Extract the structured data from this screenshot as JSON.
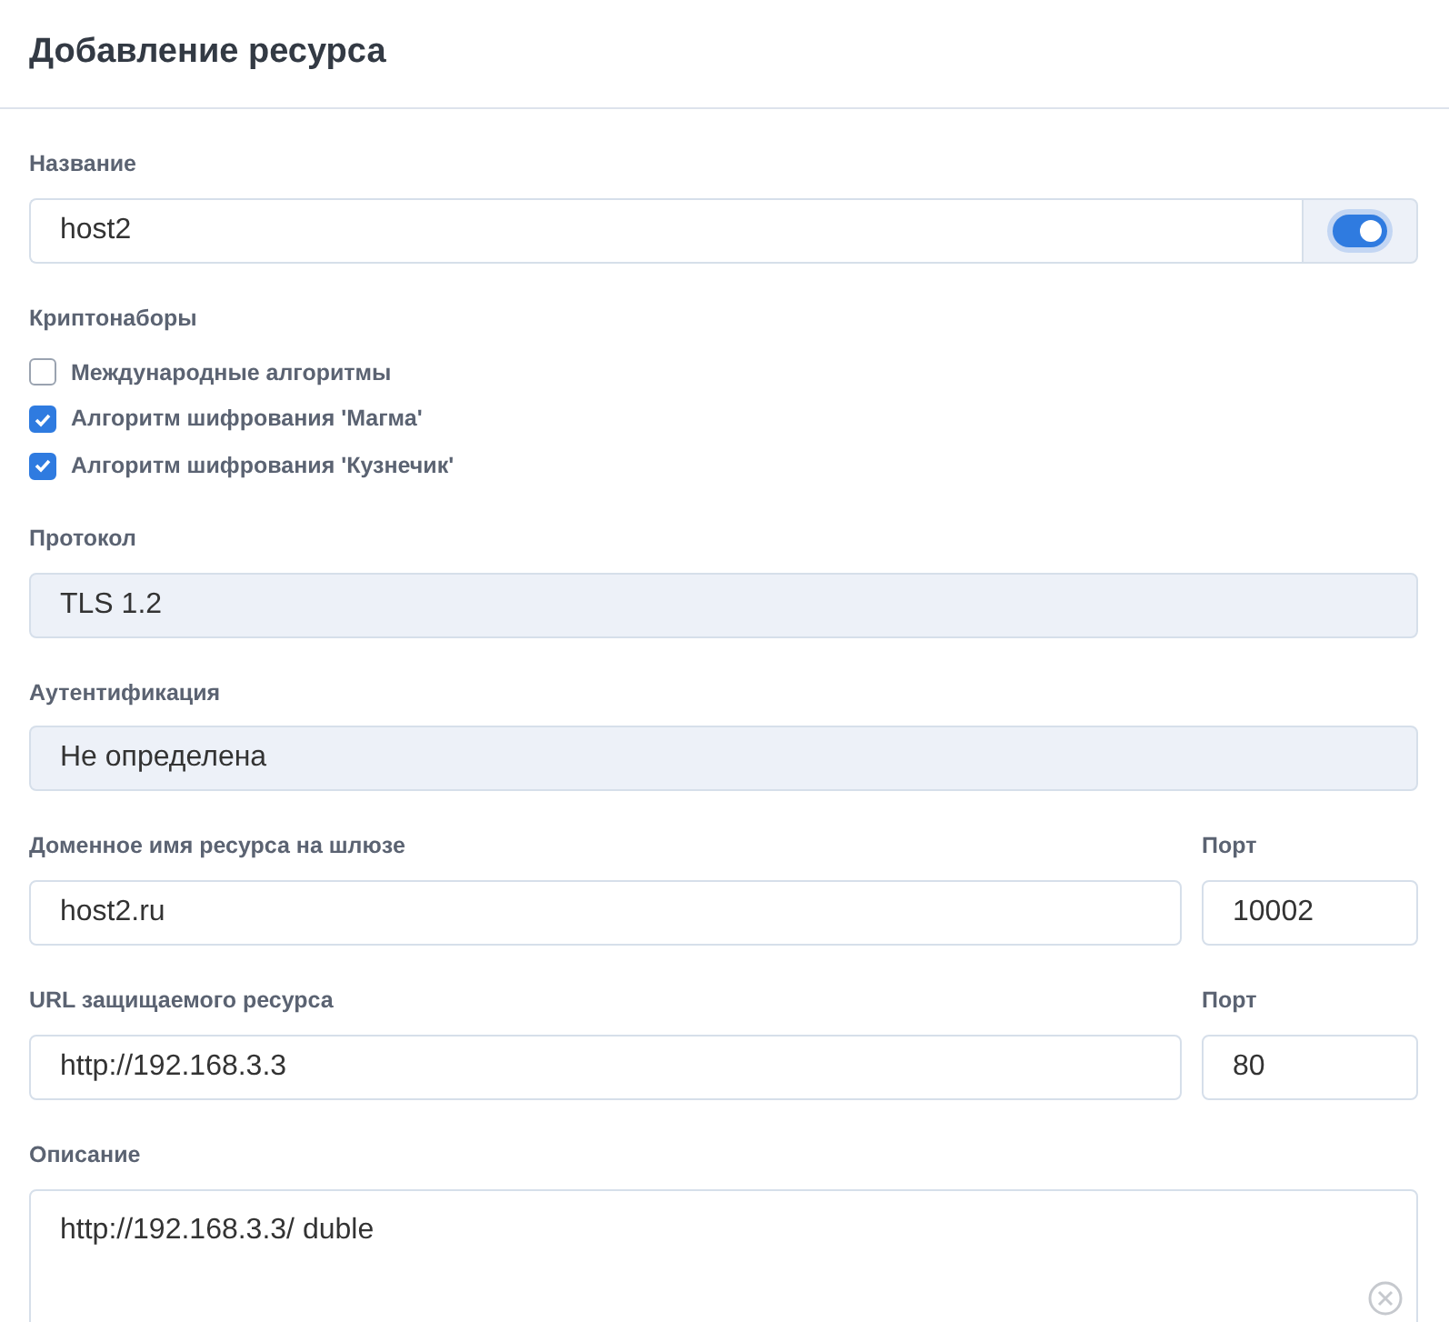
{
  "header": {
    "title": "Добавление ресурса"
  },
  "name_field": {
    "label": "Название",
    "value": "host2",
    "enabled": true
  },
  "cipher_suites": {
    "label": "Криптонаборы",
    "options": [
      {
        "label": "Международные алгоритмы",
        "checked": false
      },
      {
        "label": "Алгоритм шифрования 'Магма'",
        "checked": true
      },
      {
        "label": "Алгоритм шифрования 'Кузнечик'",
        "checked": true
      }
    ]
  },
  "protocol": {
    "label": "Протокол",
    "value": "TLS 1.2",
    "disabled": true
  },
  "authentication": {
    "label": "Аутентификация",
    "value": "Не определена",
    "disabled": true
  },
  "gateway": {
    "label": "Доменное имя ресурса на шлюзе",
    "value": "host2.ru",
    "port_label": "Порт",
    "port": "10002"
  },
  "protected_resource": {
    "label": "URL защищаемого ресурса",
    "value": "http://192.168.3.3",
    "port_label": "Порт",
    "port": "80"
  },
  "description": {
    "label": "Описание",
    "value": "http://192.168.3.3/ duble"
  }
}
